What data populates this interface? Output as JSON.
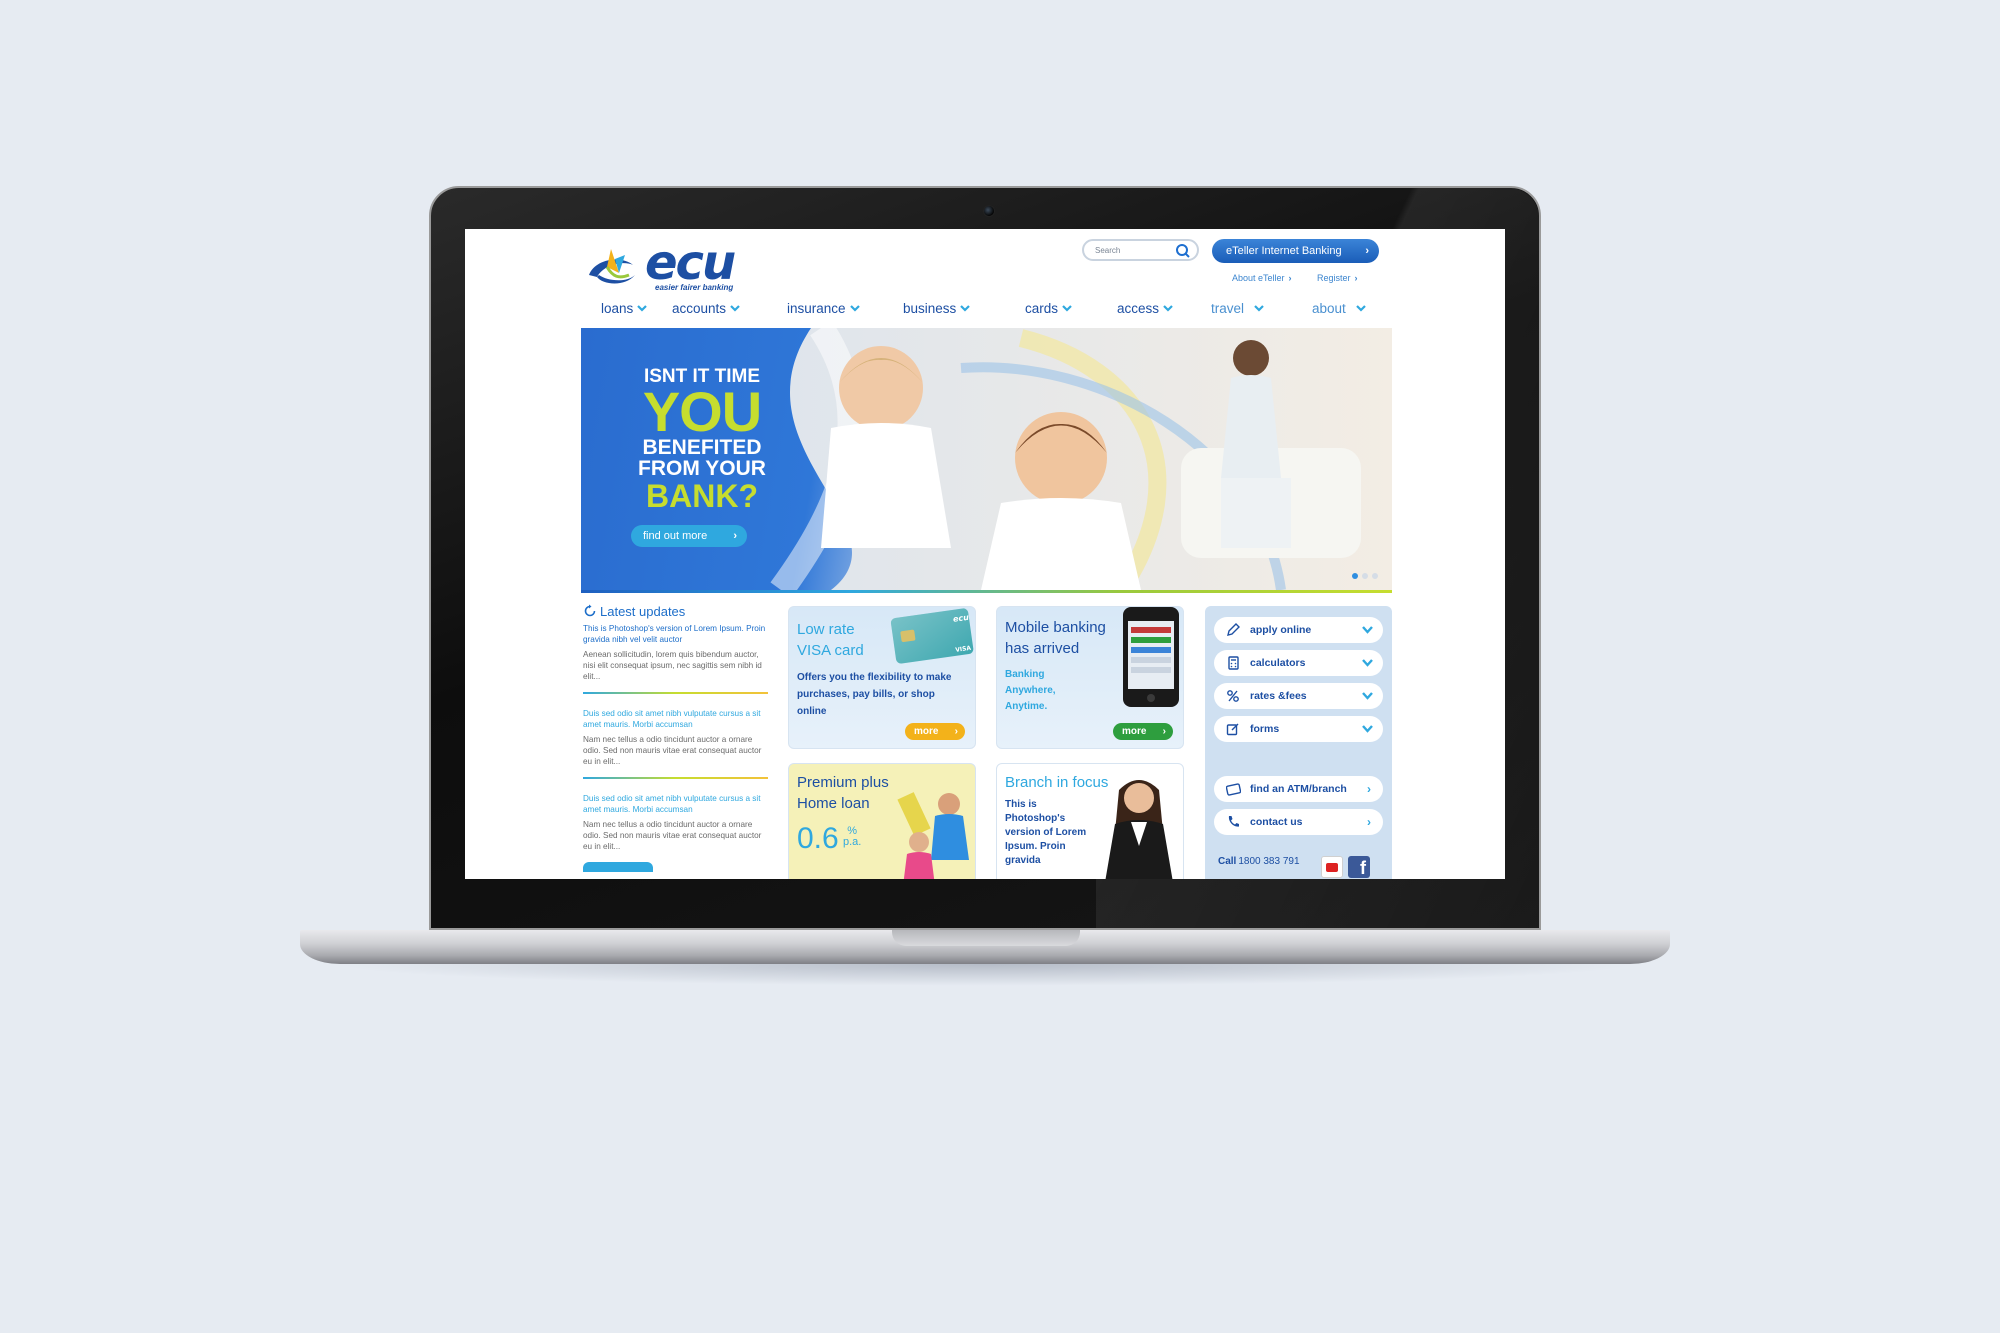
{
  "site": {
    "logo_word": "ecu",
    "tagline": "easier fairer banking"
  },
  "header": {
    "search_placeholder": "Search",
    "eteller_label": "eTeller Internet Banking",
    "about_eteller": "About eTeller",
    "register": "Register"
  },
  "nav": [
    "loans",
    "accounts",
    "insurance",
    "business",
    "cards",
    "access",
    "travel",
    "about"
  ],
  "banner": {
    "line1": "ISNT IT TIME",
    "line2": "YOU",
    "line3": "BENEFITED",
    "line4": "FROM YOUR",
    "line5": "BANK?",
    "cta": "find out more",
    "slides": 3,
    "active_slide": 1
  },
  "updates": {
    "title": "Latest updates",
    "items": [
      {
        "link": "This is Photoshop's version  of Lorem Ipsum. Proin gravida nibh vel velit auctor",
        "body": "Aenean sollicitudin, lorem quis bibendum auctor, nisi elit consequat ipsum, nec sagittis sem nibh id elit..."
      },
      {
        "link": "Duis sed odio sit amet nibh vulputate cursus a sit amet mauris. Morbi accumsan",
        "body": "Nam nec tellus a odio tincidunt auctor a ornare odio. Sed non  mauris vitae erat consequat auctor eu in elit..."
      },
      {
        "link": "Duis sed odio sit amet nibh vulputate cursus a sit amet mauris. Morbi accumsan",
        "body": "Nam nec tellus a odio tincidunt auctor a ornare odio. Sed non  mauris vitae erat consequat auctor eu in elit..."
      }
    ]
  },
  "cards": {
    "visa": {
      "title1": "Low rate",
      "title2": "VISA card",
      "body": "Offers you the flexibility to make purchases, pay bills, or shop online",
      "more": "more",
      "card_brand": "ecu",
      "card_visa": "VISA"
    },
    "mobile": {
      "title1": "Mobile banking",
      "title2": "has arrived",
      "body1": "Banking",
      "body2": "Anywhere,",
      "body3": "Anytime.",
      "more": "more"
    },
    "loan": {
      "title1": "Premium plus",
      "title2": "Home loan",
      "rate": "0.6",
      "rate_unit_top": "%",
      "rate_unit_bottom": "p.a."
    },
    "branch": {
      "title": "Branch in focus",
      "body": "This is Photoshop's version  of Lorem Ipsum. Proin gravida"
    }
  },
  "side": {
    "buttons": [
      {
        "label": "apply online",
        "icon": "pencil-icon"
      },
      {
        "label": "calculators",
        "icon": "calculator-icon"
      },
      {
        "label": "rates &fees",
        "icon": "percent-icon"
      },
      {
        "label": "forms",
        "icon": "form-icon"
      }
    ],
    "links": [
      {
        "label": "find an ATM/branch",
        "icon": "card-icon"
      },
      {
        "label": "contact us",
        "icon": "phone-icon"
      }
    ],
    "call_label": "Call",
    "call_number": "1800 383 791"
  },
  "colors": {
    "brand_blue": "#1d4fa3",
    "accent_blue": "#2fa8df",
    "lime": "#c6dd2f",
    "orange": "#f3b21a",
    "green": "#2e9e3e"
  }
}
